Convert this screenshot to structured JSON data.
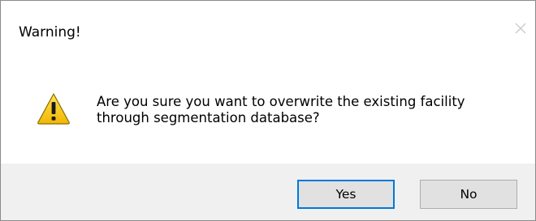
{
  "dialog": {
    "title": "Warning!",
    "icon": "warning-icon",
    "message_lines": [
      "Are you sure you want to overwrite the existing facility",
      "through segmentation database?"
    ],
    "buttons": {
      "yes_label": "Yes",
      "no_label": "No"
    },
    "colors": {
      "footer_bg": "#f0f0f0",
      "default_button_border": "#0078d7",
      "warning_yellow": "#f5c518"
    }
  }
}
